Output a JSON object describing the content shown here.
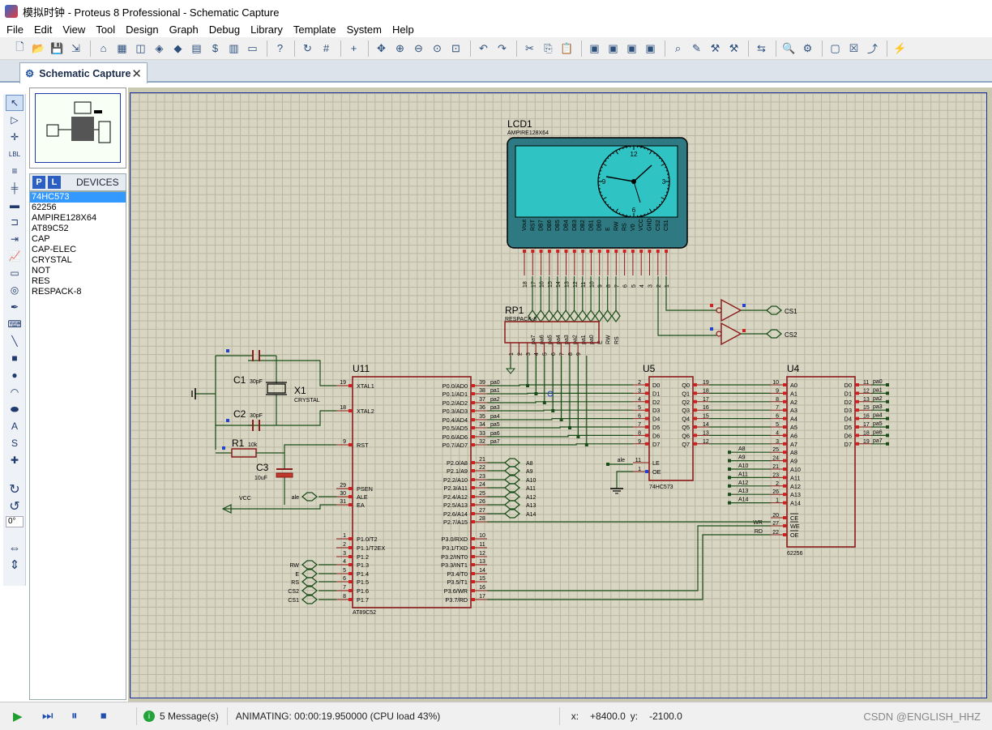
{
  "window": {
    "title": "模拟时钟 - Proteus 8 Professional - Schematic Capture"
  },
  "menu": [
    "File",
    "Edit",
    "View",
    "Tool",
    "Design",
    "Graph",
    "Debug",
    "Library",
    "Template",
    "System",
    "Help"
  ],
  "tab": {
    "label": "Schematic Capture"
  },
  "devices": {
    "picker_p": "P",
    "picker_l": "L",
    "header": "DEVICES",
    "items": [
      "74HC573",
      "62256",
      "AMPIRE128X64",
      "AT89C52",
      "CAP",
      "CAP-ELEC",
      "CRYSTAL",
      "NOT",
      "RES",
      "RESPACK-8"
    ],
    "selected": "74HC573"
  },
  "rotation": "0°",
  "status": {
    "messages": "5 Message(s)",
    "animating": "ANIMATING: 00:00:19.950000 (CPU load 43%)",
    "x_label": "x:",
    "x_value": "+8400.0",
    "y_label": "y:",
    "y_value": "-2100.0",
    "watermark": "CSDN @ENGLISH_HHZ"
  },
  "schematic": {
    "lcd": {
      "ref": "LCD1",
      "part": "AMPIRE128X64",
      "pins": [
        "Vout",
        "RST",
        "DB7",
        "DB6",
        "DB5",
        "DB4",
        "DB3",
        "DB2",
        "DB1",
        "DB0",
        "E",
        "RW",
        "RS",
        "V0",
        "VCC",
        "GND",
        "CS2",
        "CS1"
      ],
      "pin_numbers": [
        "18",
        "17",
        "16",
        "15",
        "14",
        "13",
        "12",
        "11",
        "10",
        "9",
        "8",
        "7",
        "6",
        "5",
        "4",
        "3",
        "2",
        "1"
      ],
      "bus_labels": [
        "pa7",
        "pa6",
        "pa5",
        "pa4",
        "pa3",
        "pa2",
        "pa1",
        "pa0",
        "E",
        "RW",
        "RS"
      ],
      "clock_numbers": [
        "12",
        "3",
        "6",
        "9"
      ]
    },
    "rp1": {
      "ref": "RP1",
      "part": "RESPACK-8",
      "pins": [
        "1",
        "2",
        "3",
        "4",
        "5",
        "6",
        "7",
        "8",
        "9"
      ]
    },
    "u11": {
      "ref": "U11",
      "part": "AT89C52",
      "left_pins": [
        [
          "19",
          "XTAL1"
        ],
        [
          "18",
          "XTAL2"
        ],
        [
          "9",
          "RST"
        ],
        [
          "29",
          "PSEN"
        ],
        [
          "30",
          "ALE"
        ],
        [
          "31",
          "EA"
        ],
        [
          "1",
          "P1.0/T2"
        ],
        [
          "2",
          "P1.1/T2EX"
        ],
        [
          "3",
          "P1.2"
        ],
        [
          "4",
          "P1.3"
        ],
        [
          "5",
          "P1.4"
        ],
        [
          "6",
          "P1.5"
        ],
        [
          "7",
          "P1.6"
        ],
        [
          "8",
          "P1.7"
        ]
      ],
      "right_pins": [
        [
          "39",
          "P0.0/AD0"
        ],
        [
          "38",
          "P0.1/AD1"
        ],
        [
          "37",
          "P0.2/AD2"
        ],
        [
          "36",
          "P0.3/AD3"
        ],
        [
          "35",
          "P0.4/AD4"
        ],
        [
          "34",
          "P0.5/AD5"
        ],
        [
          "33",
          "P0.6/AD6"
        ],
        [
          "32",
          "P0.7/AD7"
        ],
        [
          "21",
          "P2.0/A8"
        ],
        [
          "22",
          "P2.1/A9"
        ],
        [
          "23",
          "P2.2/A10"
        ],
        [
          "24",
          "P2.3/A11"
        ],
        [
          "25",
          "P2.4/A12"
        ],
        [
          "26",
          "P2.5/A13"
        ],
        [
          "27",
          "P2.6/A14"
        ],
        [
          "28",
          "P2.7/A15"
        ],
        [
          "10",
          "P3.0/RXD"
        ],
        [
          "11",
          "P3.1/TXD"
        ],
        [
          "12",
          "P3.2/INT0"
        ],
        [
          "13",
          "P3.3/INT1"
        ],
        [
          "14",
          "P3.4/T0"
        ],
        [
          "15",
          "P3.5/T1"
        ],
        [
          "16",
          "P3.6/WR"
        ],
        [
          "17",
          "P3.7/RD"
        ]
      ],
      "p0_labels": [
        "pa0",
        "pa1",
        "pa2",
        "pa3",
        "pa4",
        "pa5",
        "pa6",
        "pa7"
      ],
      "p2_labels": [
        "A8",
        "A9",
        "A10",
        "A11",
        "A12",
        "A13",
        "A14"
      ],
      "p1_labels": [
        "RW",
        "E",
        "RS",
        "CS2",
        "CS1"
      ]
    },
    "u5": {
      "ref": "U5",
      "part": "74HC573",
      "inputs": [
        "D0",
        "D1",
        "D2",
        "D3",
        "D4",
        "D5",
        "D6",
        "D7"
      ],
      "in_nums": [
        "2",
        "3",
        "4",
        "5",
        "6",
        "7",
        "8",
        "9"
      ],
      "outputs": [
        "Q0",
        "Q1",
        "Q2",
        "Q3",
        "Q4",
        "Q5",
        "Q6",
        "Q7"
      ],
      "out_nums": [
        "19",
        "18",
        "17",
        "16",
        "15",
        "14",
        "13",
        "12"
      ],
      "le": "LE",
      "oe": "OE",
      "le_num": "11",
      "oe_num": "1",
      "ale": "ale"
    },
    "u4": {
      "ref": "U4",
      "part": "62256",
      "addr": [
        "A0",
        "A1",
        "A2",
        "A3",
        "A4",
        "A5",
        "A6",
        "A7",
        "A8",
        "A9",
        "A10",
        "A11",
        "A12",
        "A13",
        "A14"
      ],
      "addr_nums": [
        "10",
        "9",
        "8",
        "7",
        "6",
        "5",
        "4",
        "3",
        "25",
        "24",
        "21",
        "23",
        "2",
        "26",
        "1"
      ],
      "data": [
        "D0",
        "D1",
        "D2",
        "D3",
        "D4",
        "D5",
        "D6",
        "D7"
      ],
      "data_nums": [
        "11",
        "12",
        "13",
        "15",
        "16",
        "17",
        "18",
        "19"
      ],
      "ctrl": [
        "CE",
        "WE",
        "OE"
      ],
      "ctrl_nums": [
        "20",
        "27",
        "22"
      ],
      "ext_addr": [
        "A8",
        "A9",
        "A10",
        "A11",
        "A12",
        "A13",
        "A14"
      ],
      "pa_labels": [
        "pa0",
        "pa1",
        "pa2",
        "pa3",
        "pa4",
        "pa5",
        "pa6",
        "pa7"
      ],
      "wr": "WR",
      "rd": "RD"
    },
    "x1": {
      "ref": "X1",
      "part": "CRYSTAL"
    },
    "c1": {
      "ref": "C1",
      "value": "30pF"
    },
    "c2": {
      "ref": "C2",
      "value": "30pF"
    },
    "c3": {
      "ref": "C3",
      "value": "10uF"
    },
    "r1": {
      "ref": "R1",
      "value": "10k"
    },
    "vcc": "VCC",
    "ale": "ale",
    "cs1": "CS1",
    "cs2": "CS2"
  }
}
